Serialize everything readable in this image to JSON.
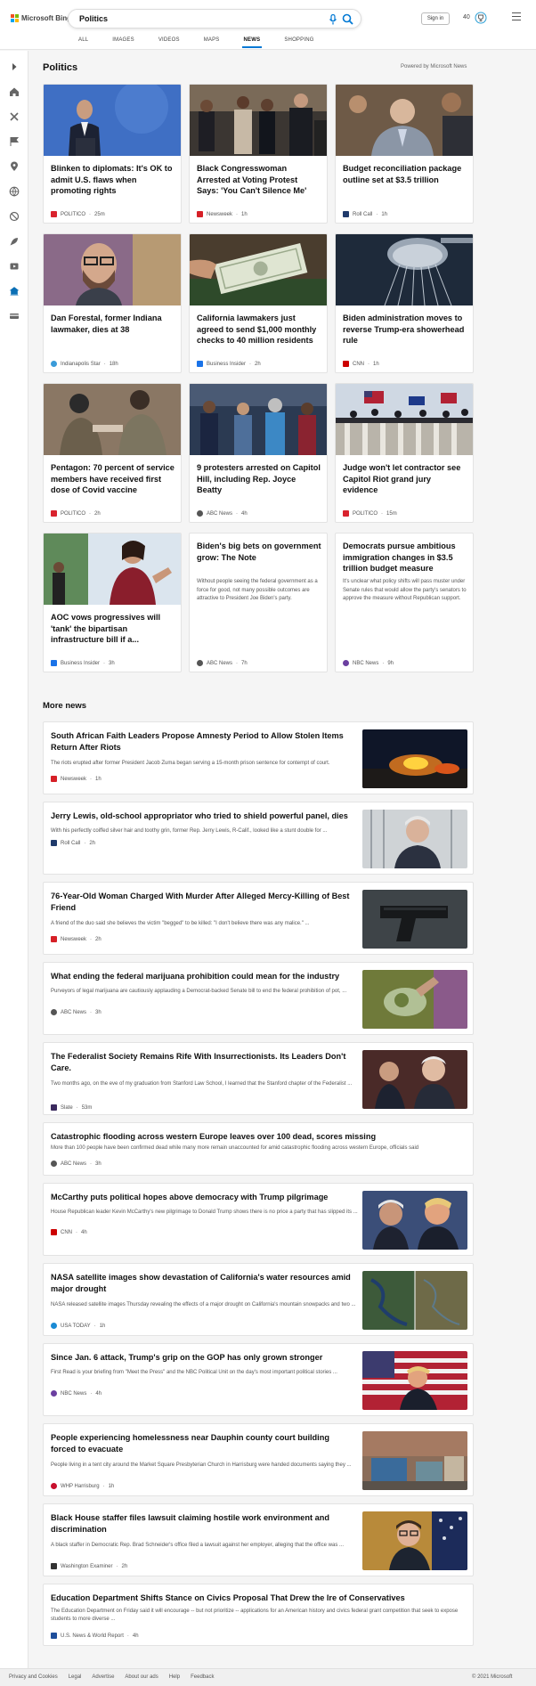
{
  "header": {
    "logo_text": "Microsoft Bing",
    "search_value": "Politics",
    "signin_label": "Sign in",
    "points": "40",
    "tabs": [
      "ALL",
      "IMAGES",
      "VIDEOS",
      "MAPS",
      "NEWS",
      "SHOPPING"
    ],
    "active_tab": "NEWS"
  },
  "section": {
    "title": "Politics",
    "powered": "Powered by Microsoft News"
  },
  "cards": [
    {
      "title": "Blinken to diplomats: It's OK to admit U.S. flaws when promoting rights",
      "source": "POLITICO",
      "time": "25m",
      "logo_color": "#d9232e"
    },
    {
      "title": "Black Congresswoman Arrested at Voting Protest Says: 'You Can't Silence Me'",
      "source": "Newsweek",
      "time": "1h",
      "logo_color": "#d62027"
    },
    {
      "title": "Budget reconciliation package outline set at $3.5 trillion",
      "source": "Roll Call",
      "time": "1h",
      "logo_color": "#1f3a6b"
    },
    {
      "title": "Dan Forestal, former Indiana lawmaker, dies at 38",
      "source": "Indianapolis Star",
      "time": "18h",
      "logo_color": "#3a9bd9"
    },
    {
      "title": "California lawmakers just agreed to send $1,000 monthly checks to 40 million residents",
      "source": "Business Insider",
      "time": "2h",
      "logo_color": "#1a73e8"
    },
    {
      "title": "Biden administration moves to reverse Trump-era showerhead rule",
      "source": "CNN",
      "time": "1h",
      "logo_color": "#cc0000"
    },
    {
      "title": "Pentagon: 70 percent of service members have received first dose of Covid vaccine",
      "source": "POLITICO",
      "time": "2h",
      "logo_color": "#d9232e"
    },
    {
      "title": "9 protesters arrested on Capitol Hill, including Rep. Joyce Beatty",
      "source": "ABC News",
      "time": "4h",
      "logo_color": "#555555"
    },
    {
      "title": "Judge won't let contractor see Capitol Riot grand jury evidence",
      "source": "POLITICO",
      "time": "15m",
      "logo_color": "#d9232e"
    },
    {
      "title": "AOC vows progressives will 'tank' the bipartisan infrastructure bill if a...",
      "source": "Business Insider",
      "time": "3h",
      "logo_color": "#1a73e8"
    },
    {
      "title": "Biden's big bets on government grow: The Note",
      "snippet": "Without people seeing the federal government as a force for good, not many possible outcomes are attractive to President Joe Biden's party.",
      "source": "ABC News",
      "time": "7h",
      "logo_color": "#555555"
    },
    {
      "title": "Democrats pursue ambitious immigration changes in $3.5 trillion budget measure",
      "snippet": "It's unclear what policy shifts will pass muster under Senate rules that would allow the party's senators to approve the measure without Republican support.",
      "source": "NBC News",
      "time": "9h",
      "logo_color": "#6b3fa0"
    }
  ],
  "more_title": "More news",
  "more": [
    {
      "title": "South African Faith Leaders Propose Amnesty Period to Allow Stolen Items Return After Riots",
      "snippet": "The riots erupted after former President Jacob Zuma began serving a 15-month prison sentence for contempt of court.",
      "source": "Newsweek",
      "time": "1h",
      "logo_color": "#d62027"
    },
    {
      "title": "Jerry Lewis, old-school appropriator who tried to shield powerful panel, dies",
      "snippet": "With his perfectly coiffed silver hair and toothy grin, former Rep. Jerry Lewis, R-Calif., looked like a stunt double for ...",
      "source": "Roll Call",
      "time": "2h",
      "logo_color": "#1f3a6b"
    },
    {
      "title": "76-Year-Old Woman Charged With Murder After Alleged Mercy-Killing of Best Friend",
      "snippet": "A friend of the duo said she believes the victim \"begged\" to be killed: \"I don't believe there was any malice.\" ...",
      "source": "Newsweek",
      "time": "2h",
      "logo_color": "#d62027"
    },
    {
      "title": "What ending the federal marijuana prohibition could mean for the industry",
      "snippet": "Purveyors of legal marijuana are cautiously applauding a Democrat-backed Senate bill to end the federal prohibition of pot, ...",
      "source": "ABC News",
      "time": "3h",
      "logo_color": "#555555"
    },
    {
      "title": "The Federalist Society Remains Rife With Insurrectionists. Its Leaders Don't Care.",
      "snippet": "Two months ago, on the eve of my graduation from Stanford Law School, I learned that the Stanford chapter of the Federalist ...",
      "source": "Slate",
      "time": "53m",
      "logo_color": "#3b2a5e"
    },
    {
      "title": "Catastrophic flooding across western Europe leaves over 100 dead, scores missing",
      "snippet": "More than 100 people have been confirmed dead while many more remain unaccounted for amid catastrophic flooding across western Europe, officials said",
      "source": "ABC News",
      "time": "3h",
      "logo_color": "#555555"
    },
    {
      "title": "McCarthy puts political hopes above democracy with Trump pilgrimage",
      "snippet": "House Republican leader Kevin McCarthy's new pilgrimage to Donald Trump shows there is no price a party that has slipped its ...",
      "source": "CNN",
      "time": "4h",
      "logo_color": "#cc0000"
    },
    {
      "title": "NASA satellite images show devastation of California's water resources amid major drought",
      "snippet": "NASA released satellite images Thursday revealing the effects of a major drought on California's mountain snowpacks and two ...",
      "source": "USA TODAY",
      "time": "1h",
      "logo_color": "#1a8ad4"
    },
    {
      "title": "Since Jan. 6 attack, Trump's grip on the GOP has only grown stronger",
      "snippet": "First Read is your briefing from \"Meet the Press\" and the NBC Political Unit on the day's most important political stories ...",
      "source": "NBC News",
      "time": "4h",
      "logo_color": "#6b3fa0"
    },
    {
      "title": "People experiencing homelessness near Dauphin county court building forced to evacuate",
      "snippet": "People living in a tent city around the Market Square Presbyterian Church in Harrisburg were handed documents saying they ...",
      "source": "WHP Harrisburg",
      "time": "1h",
      "logo_color": "#c8102e"
    },
    {
      "title": "Black House staffer files lawsuit claiming hostile work environment and discrimination",
      "snippet": "A black staffer in Democratic Rep. Brad Schneider's office filed a lawsuit against her employer, alleging that the office was ...",
      "source": "Washington Examiner",
      "time": "2h",
      "logo_color": "#333333"
    },
    {
      "title": "Education Department Shifts Stance on Civics Proposal That Drew the Ire of Conservatives",
      "snippet": "The Education Department on Friday said it will encourage -- but not prioritize -- applications for an American history and civics federal grant competition that seek to expose students to more diverse ...",
      "source": "U.S. News & World Report",
      "time": "4h",
      "logo_color": "#1f4e9b"
    }
  ],
  "footer": {
    "links": [
      "Privacy and Cookies",
      "Legal",
      "Advertise",
      "About our ads",
      "Help",
      "Feedback"
    ],
    "copyright": "© 2021 Microsoft"
  }
}
